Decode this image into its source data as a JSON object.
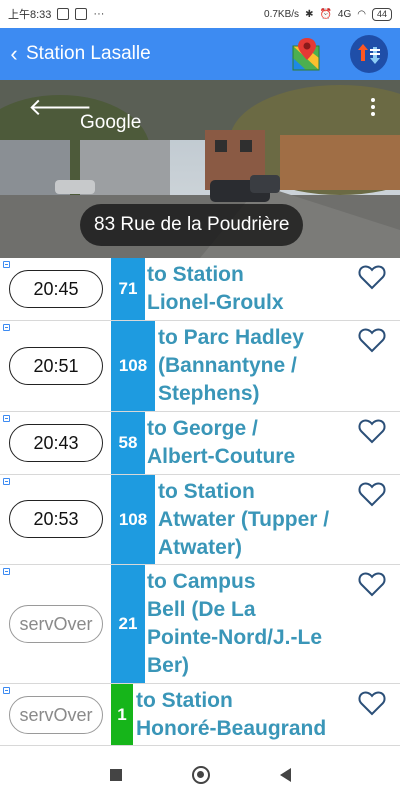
{
  "status_bar": {
    "time": "上午8:33",
    "network_speed": "0.7KB/s",
    "network_type": "4G",
    "battery": "44"
  },
  "header": {
    "title": "Station Lasalle",
    "bar_color": "#3d8bf2"
  },
  "street_view": {
    "provider": "Google",
    "address": "83 Rue de la Poudrière"
  },
  "departures": [
    {
      "time": "20:45",
      "route": "71",
      "route_color": "#1e9be0",
      "dest": [
        "to Station",
        "Lionel-Groulx"
      ],
      "status": "normal"
    },
    {
      "time": "20:51",
      "route": "108",
      "route_color": "#1e9be0",
      "dest": [
        "to Parc Hadley",
        "(Bannantyne /",
        "Stephens)"
      ],
      "status": "normal"
    },
    {
      "time": "20:43",
      "route": "58",
      "route_color": "#1e9be0",
      "dest": [
        "to George /",
        "Albert-Couture"
      ],
      "status": "normal"
    },
    {
      "time": "20:53",
      "route": "108",
      "route_color": "#1e9be0",
      "dest": [
        "to Station",
        "Atwater (Tupper /",
        "Atwater)"
      ],
      "status": "normal"
    },
    {
      "time": "servOver",
      "route": "21",
      "route_color": "#1e9be0",
      "dest": [
        "to Campus",
        "Bell (De La",
        "Pointe-Nord/J.-Le",
        "Ber)"
      ],
      "status": "dim"
    },
    {
      "time": "servOver",
      "route": "1",
      "route_color": "#16b51a",
      "dest": [
        "to Station",
        "Honoré-Beaugrand"
      ],
      "status": "dim"
    }
  ],
  "icons": {
    "back": "chevron-left-icon",
    "map": "google-maps-icon",
    "sort": "sort-arrows-icon",
    "favorite": "heart-outline-icon"
  }
}
